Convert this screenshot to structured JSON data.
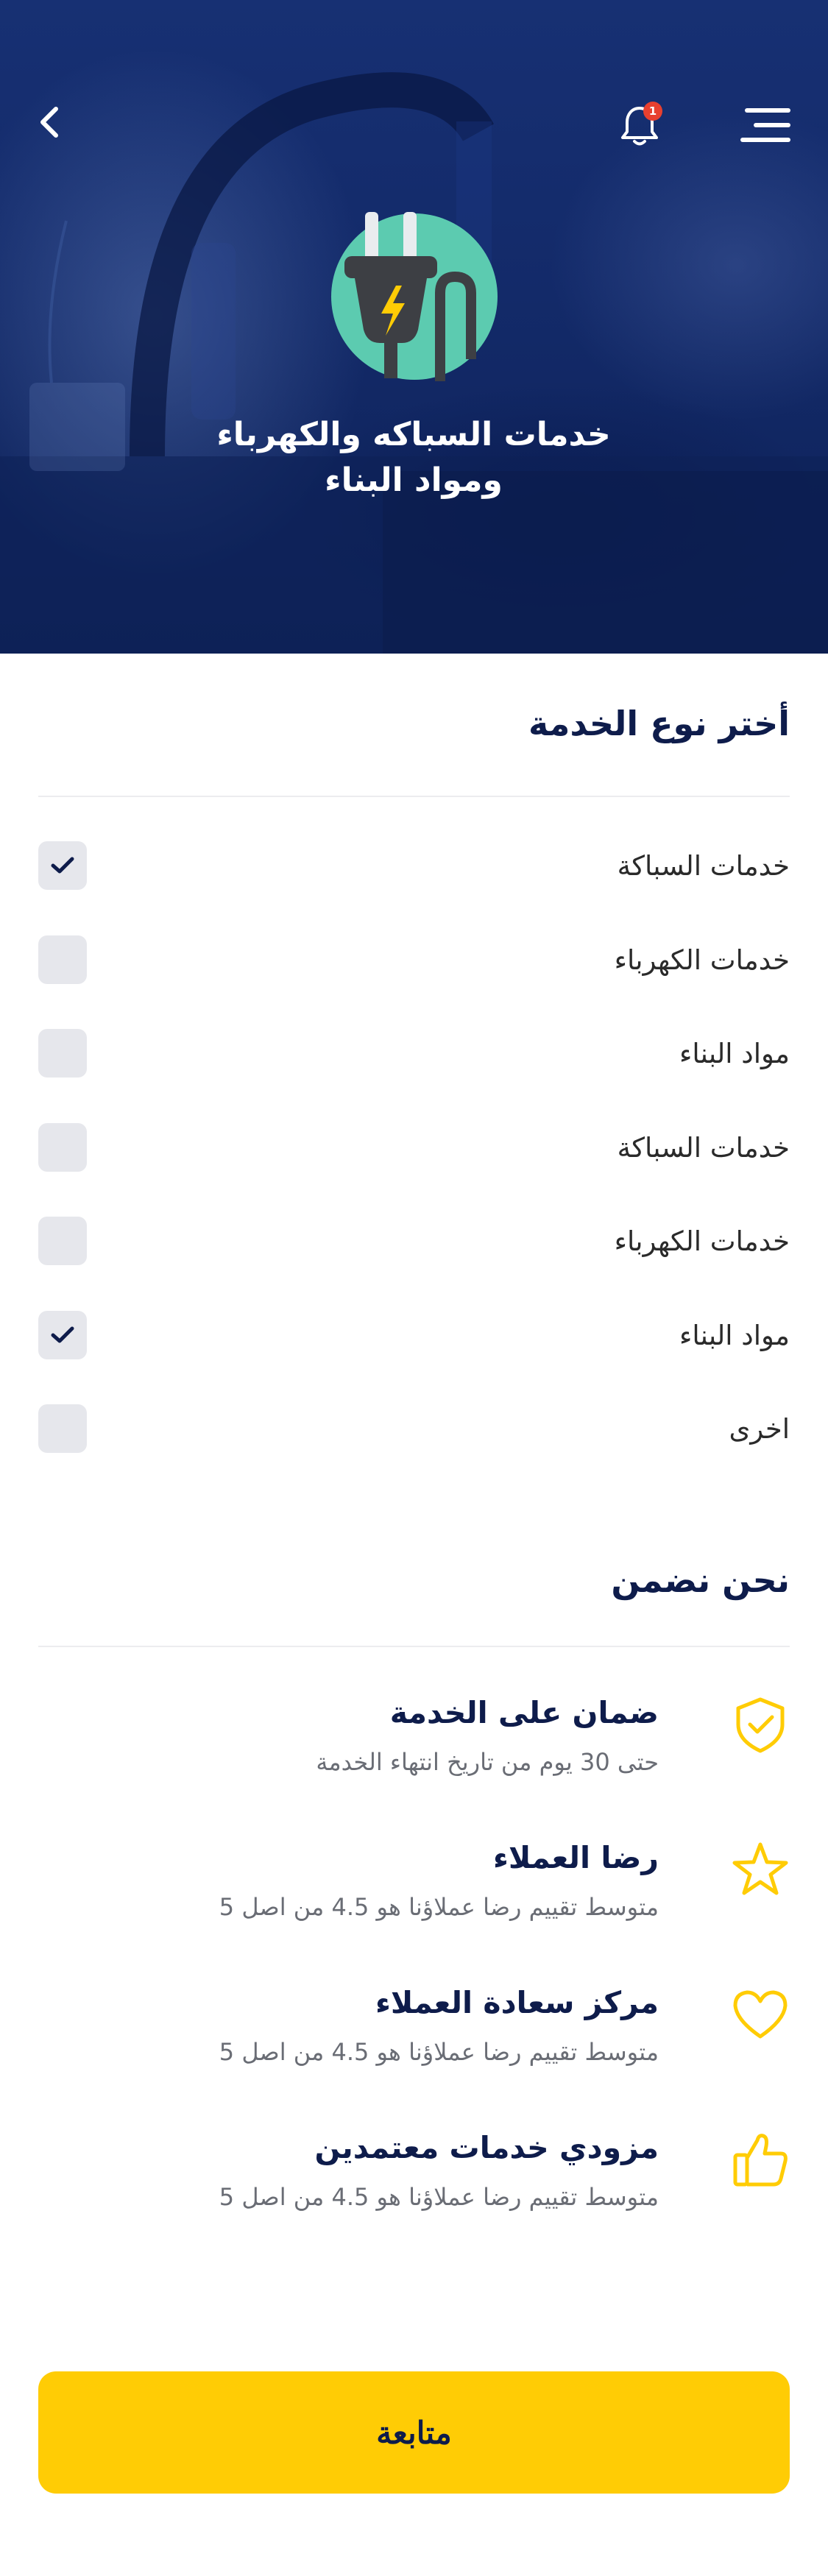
{
  "header": {
    "title": "خدمات السباكه والكهرباء\nومواد البناء",
    "notification_count": "1",
    "icons": {
      "back": "chevron-left-icon",
      "notifications": "bell-icon",
      "menu": "hamburger-menu-icon",
      "category": "electric-plug-icon"
    }
  },
  "service_type": {
    "heading": "أختر نوع الخدمة",
    "options": [
      {
        "label": "خدمات السباكة",
        "checked": true
      },
      {
        "label": "خدمات الكهرباء",
        "checked": false
      },
      {
        "label": "مواد البناء",
        "checked": false
      },
      {
        "label": "خدمات السباكة",
        "checked": false
      },
      {
        "label": "خدمات الكهرباء",
        "checked": false
      },
      {
        "label": "مواد البناء",
        "checked": true
      },
      {
        "label": "اخرى",
        "checked": false
      }
    ]
  },
  "guarantees": {
    "heading": "نحن نضمن",
    "items": [
      {
        "icon": "shield-check-icon",
        "title": "ضمان على الخدمة",
        "subtitle": "حتى 30 يوم من تاريخ انتهاء الخدمة"
      },
      {
        "icon": "star-icon",
        "title": "رضا العملاء",
        "subtitle": "متوسط تقييم رضا عملاؤنا هو 4.5 من اصل 5"
      },
      {
        "icon": "heart-icon",
        "title": "مركز سعادة العملاء",
        "subtitle": "متوسط تقييم رضا عملاؤنا هو 4.5 من اصل 5"
      },
      {
        "icon": "thumbs-up-icon",
        "title": "مزودي خدمات معتمدين",
        "subtitle": "متوسط تقييم رضا عملاؤنا هو 4.5 من اصل 5"
      }
    ]
  },
  "actions": {
    "continue_label": "متابعة"
  },
  "colors": {
    "primary": "#0e1c4b",
    "accent": "#ffcc05",
    "hero_bg": "#132a69",
    "icon_teal": "#5ccbb0",
    "badge": "#e8402f",
    "checkbox_bg": "#e6e7ec"
  }
}
